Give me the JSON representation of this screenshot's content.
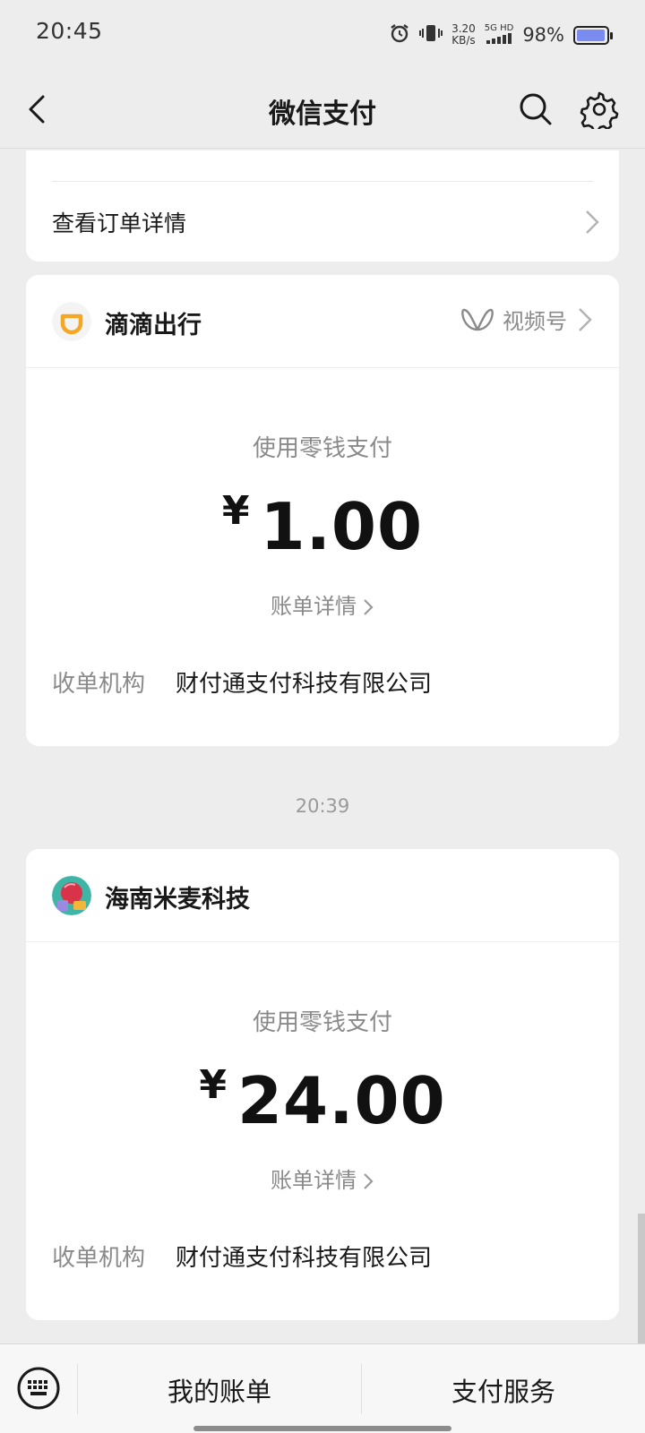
{
  "status_bar": {
    "time": "20:45",
    "net_speed_value": "3.20",
    "net_speed_unit": "KB/s",
    "signal_label": "5G HD",
    "battery_percent": "98%",
    "battery_level": 0.98
  },
  "nav": {
    "title": "微信支付"
  },
  "previous_card": {
    "view_order_label": "查看订单详情"
  },
  "transactions": [
    {
      "merchant": "滴滴出行",
      "channel_label": "视频号",
      "pay_method": "使用零钱支付",
      "currency": "¥",
      "amount": "1.00",
      "bill_detail_label": "账单详情",
      "acquirer_label": "收单机构",
      "acquirer_value": "财付通支付科技有限公司"
    },
    {
      "time_separator": "20:39",
      "merchant": "海南米麦科技",
      "pay_method": "使用零钱支付",
      "currency": "¥",
      "amount": "24.00",
      "bill_detail_label": "账单详情",
      "acquirer_label": "收单机构",
      "acquirer_value": "财付通支付科技有限公司"
    }
  ],
  "bottom_bar": {
    "my_bills": "我的账单",
    "pay_services": "支付服务"
  },
  "colors": {
    "background": "#ededed",
    "card": "#ffffff",
    "didi_orange": "#f5a623",
    "secondary_text": "#8a8a8a"
  }
}
